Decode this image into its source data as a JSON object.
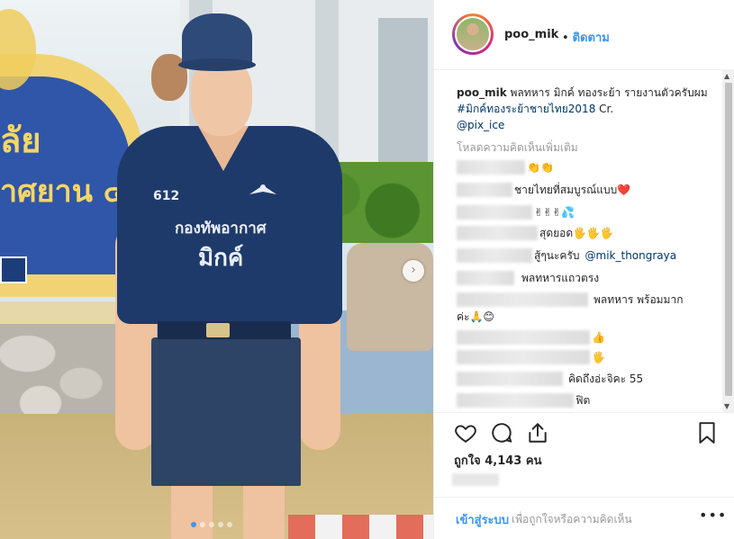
{
  "post": {
    "username": "poo_mik",
    "follow_dot": "•",
    "follow_label": "ติดตาม"
  },
  "photo": {
    "next_arrow": "›",
    "dots_total": 5,
    "dots_active": 0,
    "shirt_number": "612",
    "shirt_line1": "กองทัพอากาศ",
    "shirt_line2": "มิกค์",
    "sign_line1": "ลัย",
    "sign_line2": "าศยาน ๔"
  },
  "caption": {
    "username": "poo_mik",
    "text": "พลทหาร มิกค์ ทองระย้า รายงานตัวครับผม",
    "hashtag": "#มิกค์ทองระย้าชายไทย2018",
    "credit": "Cr.",
    "mention": "@pix_ice"
  },
  "load_more": "โหลดความคิดเห็นเพิ่มเติม",
  "comments": [
    {
      "text": "👏👏"
    },
    {
      "text": "ชายไทยที่สมบูรณ์แบบ❤️"
    },
    {
      "text": "✌✌✌💦"
    },
    {
      "text": "สุดยอด🖐🖐🖐"
    },
    {
      "text": "สู้ๆนะครับ",
      "mention": "@mik_thongraya"
    },
    {
      "text": "พลทหารแถวตรง"
    },
    {
      "text": "พลทหาร พร้อมมาก",
      "line2": "ค่ะ🙏😊"
    },
    {
      "text": "👍"
    },
    {
      "text": "🖐"
    },
    {
      "text": "คิดถึงอ่ะจิคะ 55"
    },
    {
      "text": "ฟิต"
    }
  ],
  "actions": {
    "like_icon": "heart-icon",
    "comment_icon": "comment-icon",
    "share_icon": "share-icon",
    "save_icon": "bookmark-icon"
  },
  "likes_text": "ถูกใจ 4,143 คน",
  "footer": {
    "login_label": "เข้าสู่ระบบ",
    "login_suffix": "เพื่อถูกใจหรือความคิดเห็น",
    "more_label": "•••"
  },
  "colors": {
    "accent": "#3897f0",
    "text": "#262626",
    "muted": "#999999",
    "link": "#003569",
    "border": "#efefef"
  }
}
